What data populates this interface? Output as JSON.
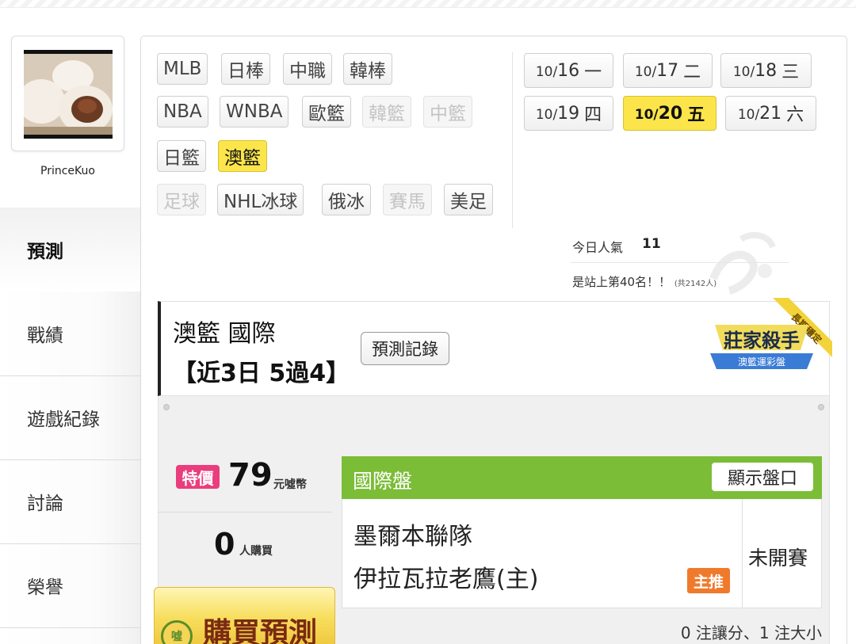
{
  "profile": {
    "username": "PrinceKuo"
  },
  "sidebar": {
    "items": [
      {
        "label": "預測",
        "active": true
      },
      {
        "label": "戰績"
      },
      {
        "label": "遊戲紀錄"
      },
      {
        "label": "討論"
      },
      {
        "label": "榮譽"
      }
    ]
  },
  "sports": {
    "row1": [
      "MLB",
      "日棒",
      "中職",
      "韓棒"
    ],
    "row2": [
      "NBA",
      "WNBA",
      "歐籃",
      "韓籃",
      "中籃"
    ],
    "row3": [
      "日籃",
      "澳籃"
    ],
    "row4": [
      "足球",
      "NHL冰球",
      "俄冰",
      "賽馬",
      "美足"
    ],
    "disabled": [
      "韓籃",
      "中籃",
      "足球",
      "賽馬"
    ],
    "active": "澳籃"
  },
  "dates": [
    {
      "month": "10/",
      "day": "16",
      "weekday": "一"
    },
    {
      "month": "10/",
      "day": "17",
      "weekday": "二"
    },
    {
      "month": "10/",
      "day": "18",
      "weekday": "三"
    },
    {
      "month": "10/",
      "day": "19",
      "weekday": "四"
    },
    {
      "month": "10/",
      "day": "20",
      "weekday": "五",
      "active": true
    },
    {
      "month": "10/",
      "day": "21",
      "weekday": "六"
    }
  ],
  "popularity": {
    "label": "今日人氣",
    "count": "11",
    "rank_text": "是站上第40名！！",
    "rank_total": "(共2142人)"
  },
  "header": {
    "title": "澳籃 國際",
    "record": "【近3日 5過4】",
    "record_button": "預測記錄",
    "badge_title": "莊家殺手",
    "badge_subtitle": "澳籃運彩盤",
    "badge_ribbon": "長期穩定"
  },
  "pricing": {
    "tag": "特價",
    "price": "79",
    "currency": "元噓幣",
    "buyers": "0",
    "buyers_unit": "人購買",
    "buy_button": "購買預測",
    "coin_text": "噓"
  },
  "match_panel": {
    "title": "國際盤",
    "show_button": "顯示盤口",
    "team1": "墨爾本聯隊",
    "team2": "伊拉瓦拉老鷹(主)",
    "pick_tag": "主推",
    "status": "未開賽",
    "bet_summary": "0 注讓分、1 注大小"
  },
  "colors": {
    "accent_yellow": "#fbe54a",
    "panel_green": "#7cbd38",
    "promo_pink": "#ea3d7d",
    "pick_orange": "#f07a2c",
    "buy_gold": "#eec53b"
  }
}
